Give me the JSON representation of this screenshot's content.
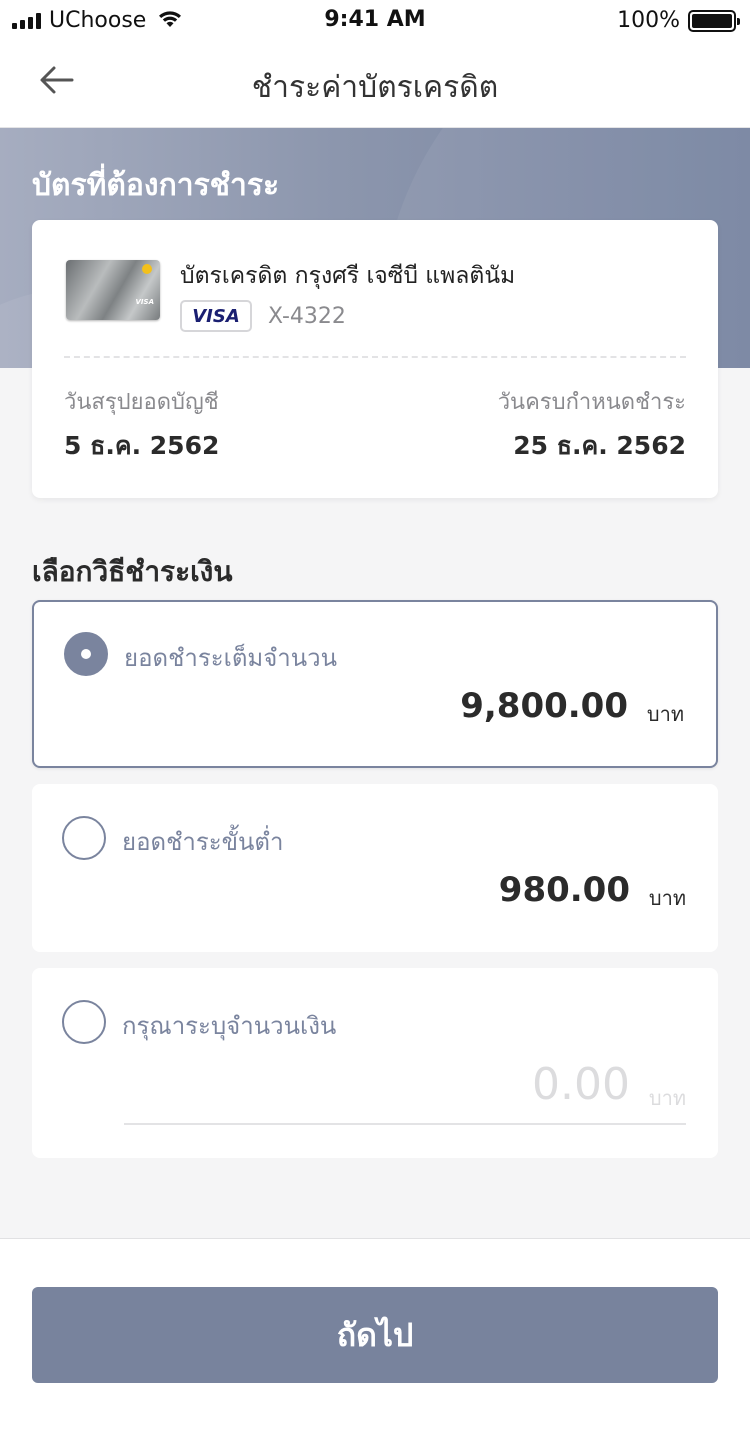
{
  "status_bar": {
    "carrier": "UChoose",
    "time": "9:41 AM",
    "battery": "100%"
  },
  "nav": {
    "title": "ชำระค่าบัตรเครดิต"
  },
  "card_section": {
    "heading": "บัตรที่ต้องการชำระ",
    "card_name": "บัตรเครดิต กรุงศรี เจซีบี แพลตินัม",
    "network": "VISA",
    "card_number": "X-4322",
    "statement_label": "วันสรุปยอดบัญชี",
    "statement_date": "5 ธ.ค. 2562",
    "due_label": "วันครบกำหนดชำระ",
    "due_date": "25 ธ.ค. 2562"
  },
  "payment_section": {
    "heading": "เลือกวิธีชำระเงิน",
    "options": [
      {
        "label": "ยอดชำระเต็มจำนวน",
        "amount": "9,800.00",
        "unit": "บาท",
        "selected": true
      },
      {
        "label": "ยอดชำระขั้นต่ำ",
        "amount": "980.00",
        "unit": "บาท",
        "selected": false
      },
      {
        "label": "กรุณาระบุจำนวนเงิน",
        "placeholder": "0.00",
        "unit": "บาท",
        "selected": false
      }
    ]
  },
  "footer": {
    "next_label": "ถัดไป"
  },
  "colors": {
    "accent": "#7a849e",
    "button": "#78839d",
    "hero_start": "#a6adc0",
    "hero_end": "#7683a0"
  },
  "icons": {
    "back": "arrow-left-icon",
    "wifi": "wifi-icon",
    "signal": "signal-icon",
    "battery": "battery-icon"
  }
}
